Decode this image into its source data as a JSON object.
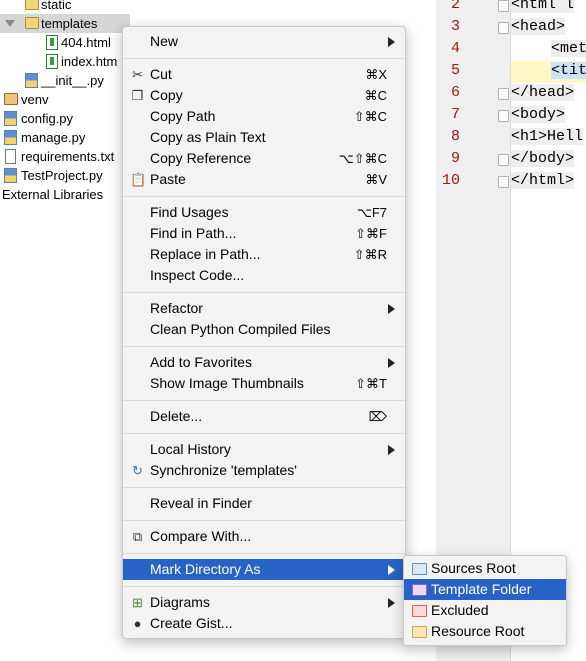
{
  "project_tree": {
    "items": [
      {
        "label": "static",
        "icon": "folder-icon"
      },
      {
        "label": "templates",
        "icon": "folder-icon"
      },
      {
        "label": "404.html",
        "icon": "html-file-icon"
      },
      {
        "label": "index.htm",
        "icon": "html-file-icon"
      },
      {
        "label": "__init__.py",
        "icon": "python-file-icon"
      },
      {
        "label": "venv",
        "icon": "folder-icon"
      },
      {
        "label": "config.py",
        "icon": "python-file-icon"
      },
      {
        "label": "manage.py",
        "icon": "python-file-icon"
      },
      {
        "label": "requirements.txt",
        "icon": "text-file-icon"
      },
      {
        "label": "TestProject.py",
        "icon": "python-file-icon"
      },
      {
        "label": "External Libraries",
        "icon": ""
      }
    ]
  },
  "editor": {
    "line_numbers": [
      "2",
      "3",
      "4",
      "5",
      "6",
      "7",
      "8",
      "9",
      "10"
    ],
    "lines": [
      "<html l",
      "<head>",
      "<met",
      "<tit",
      "</head>",
      "<body>",
      "<h1>Hell",
      "</body>",
      "</html>"
    ]
  },
  "context_menu": {
    "items": [
      {
        "label": "New",
        "shortcut": "",
        "submenu": true
      },
      {
        "label": "Cut",
        "shortcut": "⌘X",
        "icon": "scissors-icon"
      },
      {
        "label": "Copy",
        "shortcut": "⌘C",
        "icon": "copy-icon"
      },
      {
        "label": "Copy Path",
        "shortcut": "⇧⌘C"
      },
      {
        "label": "Copy as Plain Text",
        "shortcut": ""
      },
      {
        "label": "Copy Reference",
        "shortcut": "⌥⇧⌘C"
      },
      {
        "label": "Paste",
        "shortcut": "⌘V",
        "icon": "paste-icon"
      },
      {
        "label": "Find Usages",
        "shortcut": "⌥F7"
      },
      {
        "label": "Find in Path...",
        "shortcut": "⇧⌘F"
      },
      {
        "label": "Replace in Path...",
        "shortcut": "⇧⌘R"
      },
      {
        "label": "Inspect Code...",
        "shortcut": ""
      },
      {
        "label": "Refactor",
        "shortcut": "",
        "submenu": true
      },
      {
        "label": "Clean Python Compiled Files",
        "shortcut": ""
      },
      {
        "label": "Add to Favorites",
        "shortcut": "",
        "submenu": true
      },
      {
        "label": "Show Image Thumbnails",
        "shortcut": "⇧⌘T"
      },
      {
        "label": "Delete...",
        "shortcut": "⌦"
      },
      {
        "label": "Local History",
        "shortcut": "",
        "submenu": true
      },
      {
        "label": "Synchronize 'templates'",
        "shortcut": "",
        "icon": "sync-icon"
      },
      {
        "label": "Reveal in Finder",
        "shortcut": ""
      },
      {
        "label": "Compare With...",
        "shortcut": "",
        "icon": "compare-icon"
      },
      {
        "label": "Mark Directory As",
        "shortcut": "",
        "submenu": true,
        "highlighted": true
      },
      {
        "label": "Diagrams",
        "shortcut": "",
        "submenu": true,
        "icon": "diagrams-icon"
      },
      {
        "label": "Create Gist...",
        "shortcut": "",
        "icon": "github-icon"
      }
    ]
  },
  "submenu": {
    "items": [
      {
        "label": "Sources Root",
        "icon_color": "#5b8fd6"
      },
      {
        "label": "Template Folder",
        "icon_color": "#9b59c9",
        "highlighted": true
      },
      {
        "label": "Excluded",
        "icon_color": "#e25a4d"
      },
      {
        "label": "Resource Root",
        "icon_color": "#d9a13b"
      }
    ]
  },
  "colors": {
    "highlight": "#2763c7",
    "line_numbers": "#a31515"
  }
}
